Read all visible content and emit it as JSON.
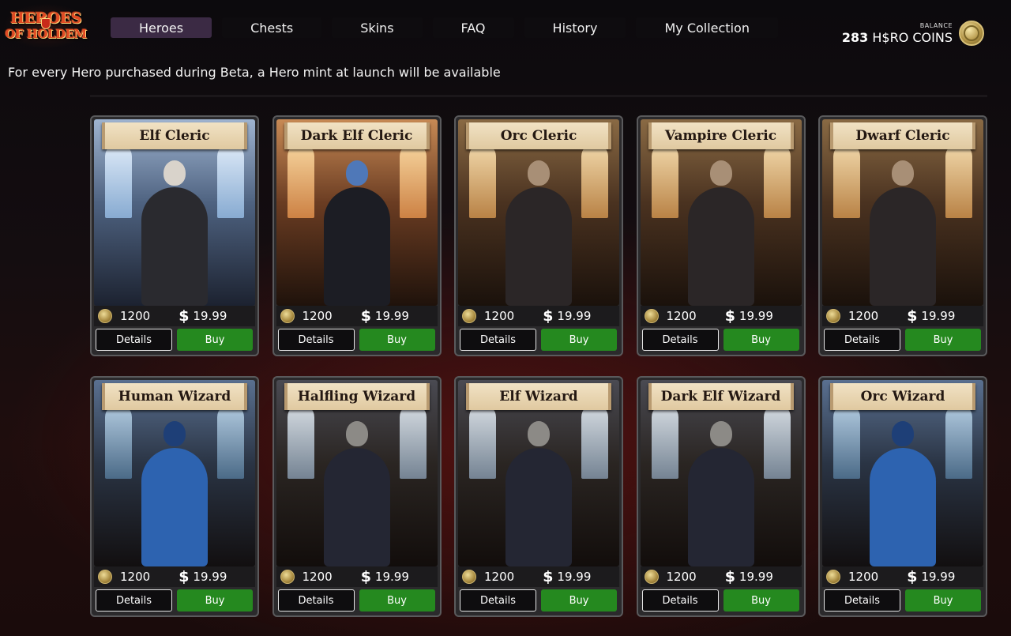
{
  "logo": {
    "line1": "HEROES",
    "line2": "OF HOLDEM"
  },
  "nav": {
    "tabs": [
      {
        "label": "Heroes",
        "active": true
      },
      {
        "label": "Chests",
        "active": false
      },
      {
        "label": "Skins",
        "active": false
      },
      {
        "label": "FAQ",
        "active": false
      },
      {
        "label": "History",
        "active": false
      },
      {
        "label": "My Collection",
        "active": false
      }
    ]
  },
  "balance": {
    "label": "BALANCE",
    "amount": "283",
    "currency": "H$RO COINS",
    "icon": "coin-icon"
  },
  "notice": "For every Hero purchased during Beta, a Hero mint at launch will be available",
  "actions": {
    "details_label": "Details",
    "buy_label": "Buy"
  },
  "heroes": [
    {
      "name": "Elf Cleric",
      "coin_price": "1200",
      "currency_symbol": "$",
      "usd_price": "19.99",
      "palette": "icy-cathedral"
    },
    {
      "name": "Dark Elf Cleric",
      "coin_price": "1200",
      "currency_symbol": "$",
      "usd_price": "19.99",
      "palette": "amber-cathedral"
    },
    {
      "name": "Orc Cleric",
      "coin_price": "1200",
      "currency_symbol": "$",
      "usd_price": "19.99",
      "palette": "warm-cathedral"
    },
    {
      "name": "Vampire Cleric",
      "coin_price": "1200",
      "currency_symbol": "$",
      "usd_price": "19.99",
      "palette": "warm-cathedral"
    },
    {
      "name": "Dwarf Cleric",
      "coin_price": "1200",
      "currency_symbol": "$",
      "usd_price": "19.99",
      "palette": "warm-cathedral"
    },
    {
      "name": "Human Wizard",
      "coin_price": "1200",
      "currency_symbol": "$",
      "usd_price": "19.99",
      "palette": "blue-library"
    },
    {
      "name": "Halfling Wizard",
      "coin_price": "1200",
      "currency_symbol": "$",
      "usd_price": "19.99",
      "palette": "dark-library"
    },
    {
      "name": "Elf Wizard",
      "coin_price": "1200",
      "currency_symbol": "$",
      "usd_price": "19.99",
      "palette": "dark-library"
    },
    {
      "name": "Dark Elf Wizard",
      "coin_price": "1200",
      "currency_symbol": "$",
      "usd_price": "19.99",
      "palette": "dark-library"
    },
    {
      "name": "Orc Wizard",
      "coin_price": "1200",
      "currency_symbol": "$",
      "usd_price": "19.99",
      "palette": "blue-library"
    }
  ],
  "colors": {
    "buy_button": "#25891f",
    "active_tab": "#3b2a44",
    "banner": "#f1e2c4"
  }
}
